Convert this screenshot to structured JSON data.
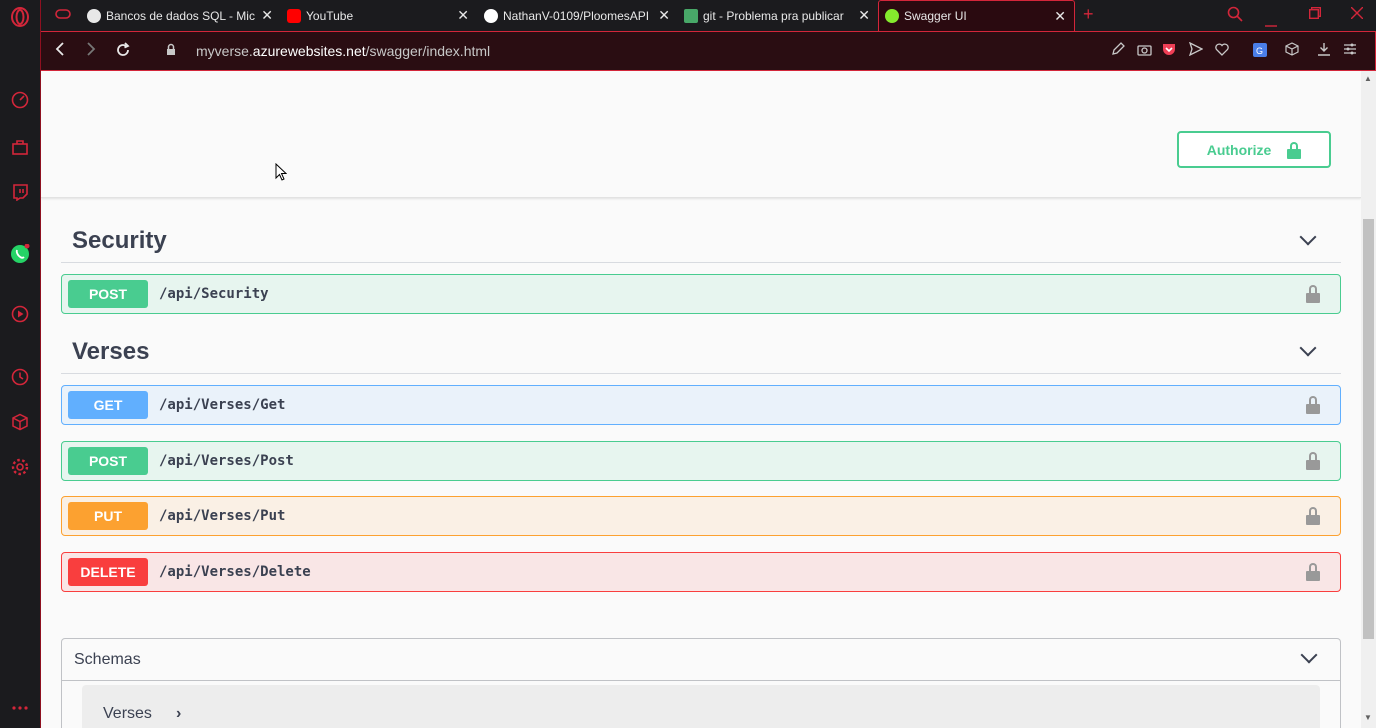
{
  "browser": {
    "tabs": [
      {
        "title": "Bancos de dados SQL - Mic",
        "favicon_color": "#e8e8e8"
      },
      {
        "title": "YouTube",
        "favicon_color": "#ff0000"
      },
      {
        "title": "NathanV-0109/PloomesAPI",
        "favicon_color": "#ffffff"
      },
      {
        "title": "git - Problema pra publicar",
        "favicon_color": "#48a868"
      },
      {
        "title": "Swagger UI",
        "favicon_color": "#85ea2d"
      }
    ],
    "new_tab": "+",
    "url_prefix": "myverse.",
    "url_host": "azurewebsites.net",
    "url_path": "/swagger/index.html",
    "accent": "#d3263a"
  },
  "swagger": {
    "authorize_label": "Authorize",
    "sections": [
      {
        "name": "Security",
        "operations": [
          {
            "method": "POST",
            "path": "/api/Security"
          }
        ]
      },
      {
        "name": "Verses",
        "operations": [
          {
            "method": "GET",
            "path": "/api/Verses/Get"
          },
          {
            "method": "POST",
            "path": "/api/Verses/Post"
          },
          {
            "method": "PUT",
            "path": "/api/Verses/Put"
          },
          {
            "method": "DELETE",
            "path": "/api/Verses/Delete"
          }
        ]
      }
    ],
    "schemas_title": "Schemas",
    "schemas": [
      {
        "name": "Verses"
      }
    ],
    "colors": {
      "post": "#49cc90",
      "get": "#61affe",
      "put": "#fca130",
      "delete": "#f93e3e"
    }
  }
}
